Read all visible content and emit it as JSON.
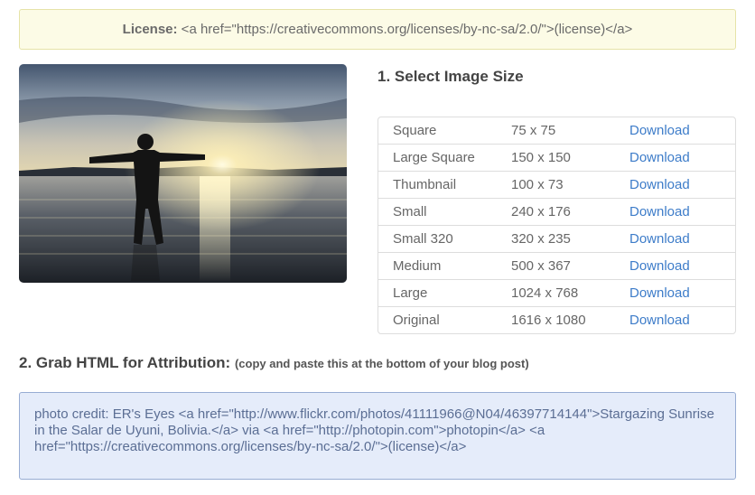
{
  "license": {
    "label": "License:",
    "code": " <a href=\"https://creativecommons.org/licenses/by-nc-sa/2.0/\">(license)</a>"
  },
  "photo": {
    "alt": "Silhouette of a man with outstretched arms standing in shallow water at sunrise"
  },
  "step1": {
    "title": "1. Select Image Size"
  },
  "sizes": [
    {
      "name": "Square",
      "dims": "75 x 75",
      "action": "Download"
    },
    {
      "name": "Large Square",
      "dims": "150 x 150",
      "action": "Download"
    },
    {
      "name": "Thumbnail",
      "dims": "100 x 73",
      "action": "Download"
    },
    {
      "name": "Small",
      "dims": "240 x 176",
      "action": "Download"
    },
    {
      "name": "Small 320",
      "dims": "320 x 235",
      "action": "Download"
    },
    {
      "name": "Medium",
      "dims": "500 x 367",
      "action": "Download"
    },
    {
      "name": "Large",
      "dims": "1024 x 768",
      "action": "Download"
    },
    {
      "name": "Original",
      "dims": "1616 x 1080",
      "action": "Download"
    }
  ],
  "step2": {
    "title": "2. Grab HTML for Attribution:",
    "note": "(copy and paste this at the bottom of your blog post)"
  },
  "attribution": {
    "html": "photo credit: ER's Eyes <a href=\"http://www.flickr.com/photos/41111966@N04/46397714144\">Stargazing Sunrise in the Salar de Uyuni, Bolivia.</a> via <a href=\"http://photopin.com\">photopin</a> <a href=\"https://creativecommons.org/licenses/by-nc-sa/2.0/\">(license)</a>"
  },
  "colors": {
    "link": "#3d7cc9",
    "license_bg": "#fcfbe6",
    "code_bg": "#e5ecfa"
  }
}
